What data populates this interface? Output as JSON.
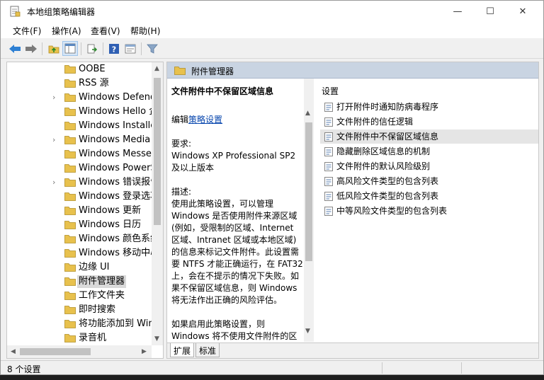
{
  "window": {
    "title": "本地组策略编辑器",
    "min_glyph": "—",
    "max_glyph": "☐",
    "close_glyph": "✕"
  },
  "menu": [
    "文件(F)",
    "操作(A)",
    "查看(V)",
    "帮助(H)"
  ],
  "toolbar": [
    "back-arrow-icon",
    "forward-arrow-icon",
    "up-folder-icon",
    "show-tree-icon",
    "export-list-icon",
    "help-icon",
    "properties-icon",
    "filter-icon"
  ],
  "tree": {
    "items": [
      {
        "label": "OOBE",
        "expander": ""
      },
      {
        "label": "RSS 源",
        "expander": ""
      },
      {
        "label": "Windows Defender",
        "expander": "›"
      },
      {
        "label": "Windows Hello 企业版",
        "expander": ""
      },
      {
        "label": "Windows Installer",
        "expander": ""
      },
      {
        "label": "Windows Media Player",
        "expander": "›"
      },
      {
        "label": "Windows Messenger",
        "expander": ""
      },
      {
        "label": "Windows PowerShell",
        "expander": ""
      },
      {
        "label": "Windows 错误报告",
        "expander": "›"
      },
      {
        "label": "Windows 登录选项",
        "expander": ""
      },
      {
        "label": "Windows 更新",
        "expander": ""
      },
      {
        "label": "Windows 日历",
        "expander": ""
      },
      {
        "label": "Windows 颜色系统",
        "expander": ""
      },
      {
        "label": "Windows 移动中心",
        "expander": ""
      },
      {
        "label": "边缘 UI",
        "expander": ""
      },
      {
        "label": "附件管理器",
        "expander": "",
        "selected": true
      },
      {
        "label": "工作文件夹",
        "expander": ""
      },
      {
        "label": "即时搜索",
        "expander": ""
      },
      {
        "label": "将功能添加到 Windows",
        "expander": ""
      },
      {
        "label": "录音机",
        "expander": ""
      }
    ]
  },
  "right": {
    "header": "附件管理器",
    "description": {
      "title": "文件附件中不保留区域信息",
      "edit_prefix": "编辑",
      "edit_link": "策略设置",
      "req_label": "要求:",
      "req_value": "Windows XP Professional SP2 及以上版本",
      "desc_label": "描述:",
      "desc_text": "使用此策略设置，可以管理 Windows 是否使用附件来源区域(例如，受限制的区域、Internet 区域、Intranet 区域或本地区域)的信息来标记文件附件。此设置需要 NTFS 才能正确运行，在 FAT32 上，会在不提示的情况下失败。如果不保留区域信息，则 Windows 将无法作出正确的风险评估。",
      "desc_text2": "如果启用此策略设置，则 Windows 将不使用文件附件的区域信息来标记文件附件。"
    },
    "column_header": "设置",
    "settings": [
      {
        "label": "打开附件时通知防病毒程序"
      },
      {
        "label": "文件附件的信任逻辑"
      },
      {
        "label": "文件附件中不保留区域信息",
        "highlight": true
      },
      {
        "label": "隐藏删除区域信息的机制"
      },
      {
        "label": "文件附件的默认风险级别"
      },
      {
        "label": "高风险文件类型的包含列表"
      },
      {
        "label": "低风险文件类型的包含列表"
      },
      {
        "label": "中等风险文件类型的包含列表"
      }
    ],
    "tabs": [
      "扩展",
      "标准"
    ]
  },
  "status": {
    "text": "8 个设置"
  },
  "colors": {
    "accent_header": "#c9d4e2",
    "folder": "#e8c14d",
    "link": "#0645ad"
  }
}
